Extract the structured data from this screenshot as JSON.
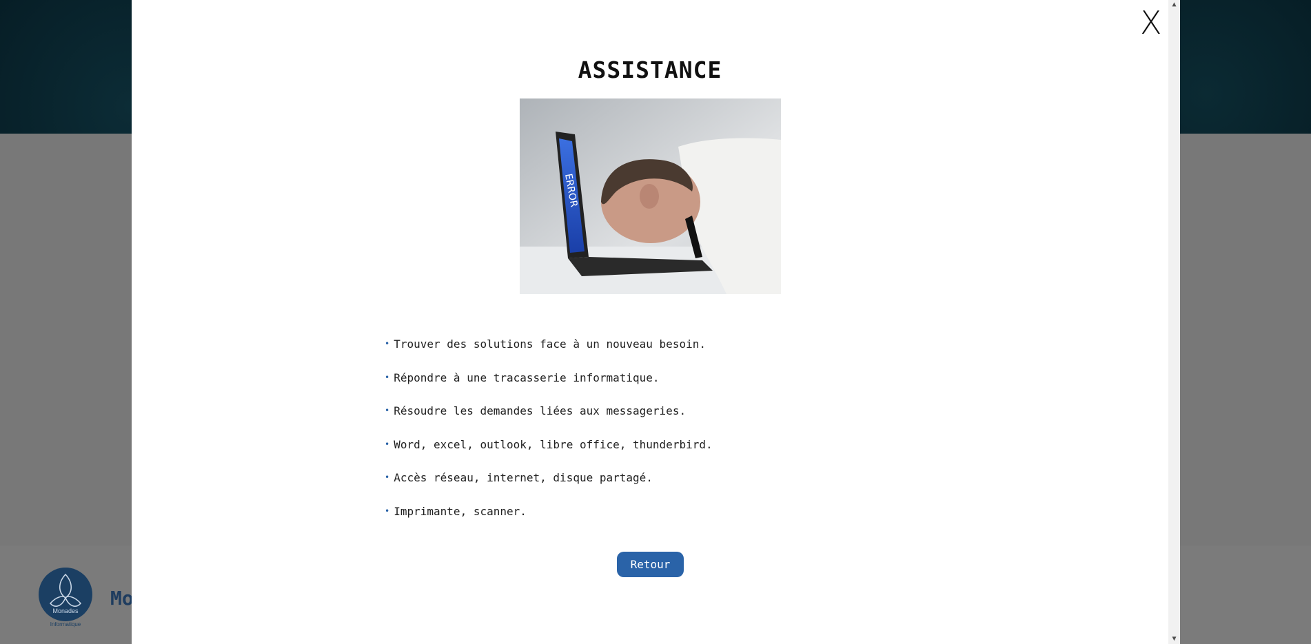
{
  "background": {
    "brand_text": "Mo",
    "logo_caption": "Monades",
    "logo_sub": "Informatique"
  },
  "modal": {
    "close_label": "X",
    "title": "ASSISTANCE",
    "image_icon": "error-laptop-photo",
    "features": [
      "Trouver des solutions face à un nouveau besoin.",
      "Répondre à une tracasserie informatique.",
      "Résoudre les demandes liées aux messageries.",
      "Word, excel, outlook, libre office, thunderbird.",
      "Accès réseau, internet, disque partagé.",
      "Imprimante, scanner."
    ],
    "back_button": "Retour"
  },
  "scrollbar": {
    "up_icon": "▲",
    "down_icon": "▼"
  },
  "colors": {
    "accent": "#2a63a8",
    "overlay": "#787878",
    "header": "#02131a"
  }
}
